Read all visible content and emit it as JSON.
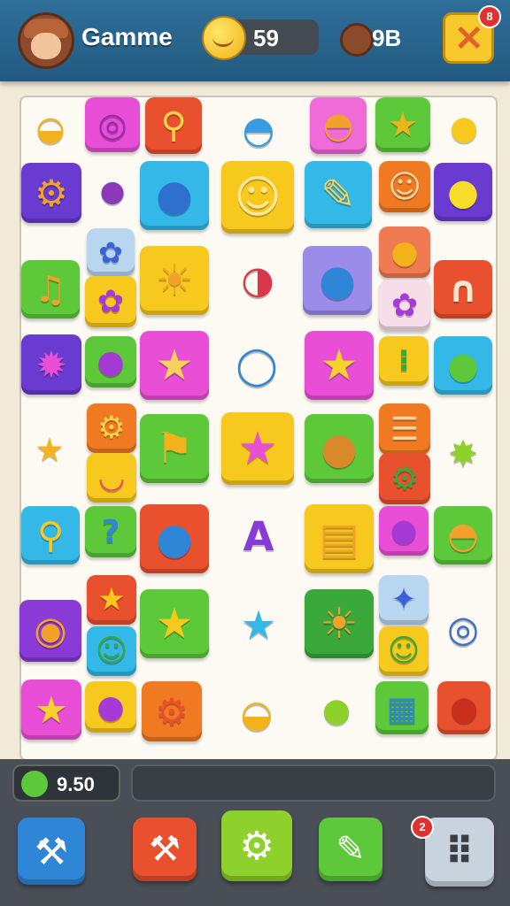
{
  "header": {
    "title": "Gamme",
    "coins": "59",
    "gems": "9B",
    "close_badge": "8"
  },
  "bottom": {
    "stat_value": "9.50",
    "progress": 0,
    "menu_badge": "2"
  },
  "tools": [
    {
      "name": "hammer-tool-button",
      "icon": "hammer-icon",
      "color": "#2f86d6",
      "glyph": "⚒"
    },
    {
      "name": "mallet-tool-button",
      "icon": "mallet-icon",
      "color": "#e8502e",
      "glyph": "⚒"
    },
    {
      "name": "gear-tool-button",
      "icon": "gear-icon",
      "color": "#8fd12c",
      "glyph": "⚙"
    },
    {
      "name": "stick-tool-button",
      "icon": "stick-icon",
      "color": "#5cc83a",
      "glyph": "✎"
    },
    {
      "name": "menu-grid-button",
      "icon": "grid-icon",
      "color": "#c9d3de",
      "glyph": "⠿"
    }
  ],
  "tiles": [
    {
      "icon": "banana-pile-icon",
      "color": "#fdfaf3",
      "fg": "#f2b21c",
      "glyph": "◒"
    },
    {
      "icon": "snail-icon",
      "color": "#e84fd6",
      "fg": "#9a2ab0",
      "glyph": "◎"
    },
    {
      "icon": "magnifier-icon",
      "color": "#e8502e",
      "fg": "#ffd24a",
      "glyph": "⚲"
    },
    {
      "icon": "blue-bowl-icon",
      "color": "#fdfaf3",
      "fg": "#3b9be0",
      "glyph": "◓"
    },
    {
      "icon": "pie-icon",
      "color": "#f06ad8",
      "fg": "#f2a12c",
      "glyph": "◓"
    },
    {
      "icon": "star-icon",
      "color": "#5cc83a",
      "fg": "#f2b21c",
      "glyph": "★"
    },
    {
      "icon": "lemon-icon",
      "color": "#fdfaf3",
      "fg": "#f7c91e",
      "glyph": "●"
    },
    {
      "icon": "gear-icon",
      "color": "#6a3bd0",
      "fg": "#f2a12c",
      "glyph": "⚙"
    },
    {
      "icon": "eggplant-icon",
      "color": "#fdfaf3",
      "fg": "#8a3ab8",
      "glyph": "●"
    },
    {
      "icon": "berry-icon",
      "color": "#33b8e8",
      "fg": "#2f6fd0",
      "glyph": "●"
    },
    {
      "icon": "smiley-face-icon",
      "color": "#f7c91e",
      "fg": "#ffe79a",
      "glyph": "☺"
    },
    {
      "icon": "feather-icon",
      "color": "#33b8e8",
      "fg": "#f7d25a",
      "glyph": "✎"
    },
    {
      "icon": "face-icon",
      "color": "#f07a22",
      "fg": "#ffd7a6",
      "glyph": "☺"
    },
    {
      "icon": "lemon-icon",
      "color": "#6a3bd0",
      "fg": "#f7dd2a",
      "glyph": "●"
    },
    {
      "icon": "grapes-icon",
      "color": "#b8d6f0",
      "fg": "#3a62d8",
      "glyph": "✿"
    },
    {
      "icon": "music-note-icon",
      "color": "#5cc83a",
      "fg": "#f2a12c",
      "glyph": "♫"
    },
    {
      "icon": "flower-icon",
      "color": "#f7c91e",
      "fg": "#a63ad6",
      "glyph": "✿"
    },
    {
      "icon": "sun-face-icon",
      "color": "#f7c91e",
      "fg": "#f2a12c",
      "glyph": "☀"
    },
    {
      "icon": "rainbow-ring-icon",
      "color": "#fdfaf3",
      "fg": "#d8384a",
      "glyph": "◑"
    },
    {
      "icon": "blueberry-icon",
      "color": "#9a8ce8",
      "fg": "#2f86d6",
      "glyph": "●"
    },
    {
      "icon": "cookie-icon",
      "color": "#f07a52",
      "fg": "#f2b21c",
      "glyph": "●"
    },
    {
      "icon": "grapes-icon",
      "color": "#f6dde8",
      "fg": "#a63ad6",
      "glyph": "✿"
    },
    {
      "icon": "horseshoe-icon",
      "color": "#e8502e",
      "fg": "#f6e6cf",
      "glyph": "∩"
    },
    {
      "icon": "sunburst-icon",
      "color": "#6a3bd0",
      "fg": "#e84fd6",
      "glyph": "✹"
    },
    {
      "icon": "bean-icon",
      "color": "#5cc83a",
      "fg": "#a63ad6",
      "glyph": "●"
    },
    {
      "icon": "star-icon",
      "color": "#e84fd6",
      "fg": "#f7d25a",
      "glyph": "★"
    },
    {
      "icon": "ring-icon",
      "color": "#fdfaf3",
      "fg": "#2f86d6",
      "glyph": "◯"
    },
    {
      "icon": "star-icon",
      "color": "#e84fd6",
      "fg": "#f7d22a",
      "glyph": "★"
    },
    {
      "icon": "peas-icon",
      "color": "#f7c91e",
      "fg": "#3aa83a",
      "glyph": "⁝"
    },
    {
      "icon": "leaf-icon",
      "color": "#33b8e8",
      "fg": "#5cc83a",
      "glyph": "●"
    },
    {
      "icon": "star-icon",
      "color": "#fdfaf3",
      "fg": "#f7b21c",
      "glyph": "★"
    },
    {
      "icon": "gear-icon",
      "color": "#f07a22",
      "fg": "#ffd24a",
      "glyph": "⚙"
    },
    {
      "icon": "boot-icon",
      "color": "#5cc83a",
      "fg": "#f2b21c",
      "glyph": "⚑"
    },
    {
      "icon": "star-icon",
      "color": "#f7c91e",
      "fg": "#e84fd6",
      "glyph": "★"
    },
    {
      "icon": "cookie-icon",
      "color": "#5cc83a",
      "fg": "#d88a2a",
      "glyph": "●"
    },
    {
      "icon": "burger-icon",
      "color": "#f07a22",
      "fg": "#ffd7a6",
      "glyph": "☰"
    },
    {
      "icon": "star-burst-icon",
      "color": "#fdfaf3",
      "fg": "#8fd12c",
      "glyph": "✸"
    },
    {
      "icon": "lips-icon",
      "color": "#f7c91e",
      "fg": "#e84f6a",
      "glyph": "◡"
    },
    {
      "icon": "gear-icon",
      "color": "#e8502e",
      "fg": "#3aa83a",
      "glyph": "⚙"
    },
    {
      "icon": "magnifier-icon",
      "color": "#33b8e8",
      "fg": "#f7c91e",
      "glyph": "⚲"
    },
    {
      "icon": "question-icon",
      "color": "#5cc83a",
      "fg": "#2f86d6",
      "glyph": "?"
    },
    {
      "icon": "bomb-icon",
      "color": "#e8502e",
      "fg": "#2f86d6",
      "glyph": "●"
    },
    {
      "icon": "letter-a-icon",
      "color": "#fdfaf3",
      "fg": "#8a3ad6",
      "glyph": "A"
    },
    {
      "icon": "paper-icon",
      "color": "#f7c91e",
      "fg": "#f2a12c",
      "glyph": "▤"
    },
    {
      "icon": "eggplant-icon",
      "color": "#e84fd6",
      "fg": "#a63ad6",
      "glyph": "●"
    },
    {
      "icon": "mushroom-icon",
      "color": "#5cc83a",
      "fg": "#f2a12c",
      "glyph": "◓"
    },
    {
      "icon": "camera-icon",
      "color": "#8a3ad6",
      "fg": "#f2a12c",
      "glyph": "◉"
    },
    {
      "icon": "star-icon",
      "color": "#e8502e",
      "fg": "#f7c91e",
      "glyph": "★"
    },
    {
      "icon": "star-icon",
      "color": "#5cc83a",
      "fg": "#f7c91e",
      "glyph": "★"
    },
    {
      "icon": "blue-star-icon",
      "color": "#fdfaf3",
      "fg": "#33b8e8",
      "glyph": "★"
    },
    {
      "icon": "sun-face-icon",
      "color": "#3aa83a",
      "fg": "#f2a12c",
      "glyph": "☀"
    },
    {
      "icon": "star-icon",
      "color": "#b8d6f0",
      "fg": "#3a62d8",
      "glyph": "✦"
    },
    {
      "icon": "orb-icon",
      "color": "#fdfaf3",
      "fg": "#3b6fc8",
      "glyph": "◎"
    },
    {
      "icon": "frog-icon",
      "color": "#33b8e8",
      "fg": "#3aa83a",
      "glyph": "☺"
    },
    {
      "icon": "frog-icon",
      "color": "#f7c91e",
      "fg": "#3aa83a",
      "glyph": "☺"
    },
    {
      "icon": "star-icon",
      "color": "#e84fd6",
      "fg": "#f7d22a",
      "glyph": "★"
    },
    {
      "icon": "eggplant-icon",
      "color": "#f7c91e",
      "fg": "#a63ad6",
      "glyph": "●"
    },
    {
      "icon": "gear-icon",
      "color": "#f07a22",
      "fg": "#e8502e",
      "glyph": "⚙"
    },
    {
      "icon": "banana-icon",
      "color": "#fdfaf3",
      "fg": "#f2b21c",
      "glyph": "◒"
    },
    {
      "icon": "leaf-icon",
      "color": "#fdfaf3",
      "fg": "#8fd12c",
      "glyph": "●"
    },
    {
      "icon": "briefcase-icon",
      "color": "#5cc83a",
      "fg": "#2f86d6",
      "glyph": "▦"
    },
    {
      "icon": "tomato-icon",
      "color": "#e8502e",
      "fg": "#c8301e",
      "glyph": "●"
    }
  ]
}
